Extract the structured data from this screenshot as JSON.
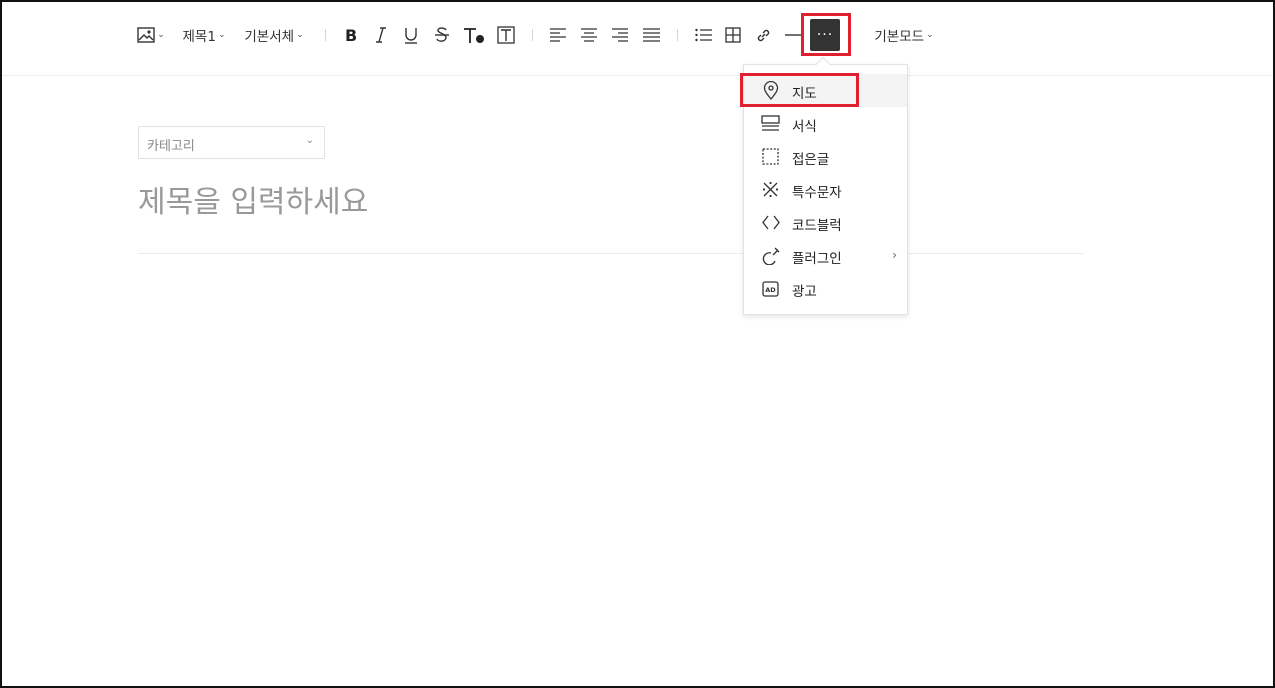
{
  "toolbar": {
    "heading_label": "제목1",
    "font_label": "기본서체",
    "mode_label": "기본모드",
    "more_label": "···",
    "caret": "⌄"
  },
  "more_menu": {
    "items": [
      {
        "label": "지도",
        "icon": "map-pin-icon"
      },
      {
        "label": "서식",
        "icon": "template-icon"
      },
      {
        "label": "접은글",
        "icon": "fold-box-icon"
      },
      {
        "label": "특수문자",
        "icon": "special-char-icon"
      },
      {
        "label": "코드블럭",
        "icon": "code-icon"
      },
      {
        "label": "플러그인",
        "icon": "plugin-icon",
        "has_submenu": true
      },
      {
        "label": "광고",
        "icon": "ad-icon"
      }
    ],
    "chevron": "›"
  },
  "editor": {
    "category_label": "카테고리",
    "title_placeholder": "제목을 입력하세요"
  },
  "colors": {
    "highlight": "#e0202e",
    "more_button_bg": "#333333"
  }
}
